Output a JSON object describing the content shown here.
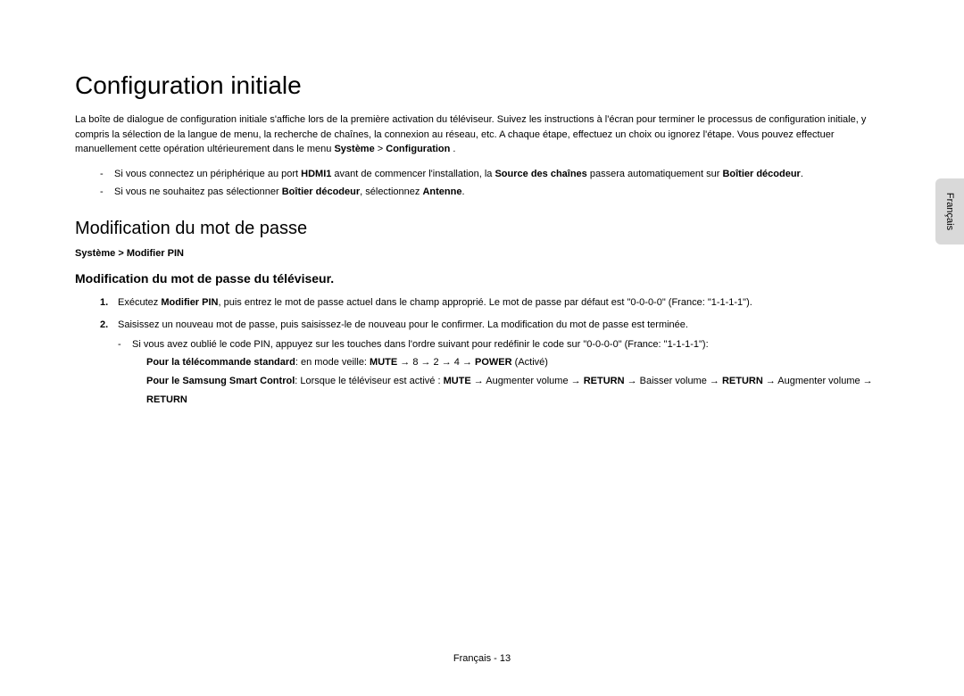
{
  "side_tab": "Français",
  "h1": "Configuration initiale",
  "intro_pre": "La boîte de dialogue de configuration initiale s'affiche lors de la première activation du téléviseur. Suivez les instructions à l'écran pour terminer le processus de configuration initiale, y compris la sélection de la langue de menu, la recherche de chaînes, la connexion au réseau, etc. A chaque étape, effectuez un choix ou ignorez l'étape. Vous pouvez effectuer manuellement cette opération ultérieurement dans le menu ",
  "intro_b1": "Système",
  "intro_gt": " > ",
  "intro_b2": "Configuration",
  "intro_post": " .",
  "bul1_pre": "Si vous connectez un périphérique au port ",
  "bul1_b1": "HDMI1",
  "bul1_mid1": " avant de commencer l'installation, la ",
  "bul1_b2": "Source des chaînes",
  "bul1_mid2": " passera automatiquement sur ",
  "bul1_b3": "Boîtier décodeur",
  "bul1_post": ".",
  "bul2_pre": "Si vous ne souhaitez pas sélectionner ",
  "bul2_b1": "Boîtier décodeur",
  "bul2_mid": ", sélectionnez ",
  "bul2_b2": "Antenne",
  "bul2_post": ".",
  "h2": "Modification du mot de passe",
  "bc_b1": "Système",
  "bc_sep": " > ",
  "bc_b2": "Modifier PIN",
  "h3": "Modification du mot de passe du téléviseur.",
  "n1_num": "1.",
  "n1_pre": "Exécutez ",
  "n1_b": "Modifier PIN",
  "n1_post": ", puis entrez le mot de passe actuel dans le champ approprié. Le mot de passe par défaut est \"0-0-0-0\" (France: \"1-1-1-1\").",
  "n2_num": "2.",
  "n2_text": "Saisissez un nouveau mot de passe, puis saisissez-le de nouveau pour le confirmer. La modification du mot de passe est terminée.",
  "d1_text": "Si vous avez oublié le code PIN, appuyez sur les touches dans l'ordre suivant pour redéfinir le code sur \"0-0-0-0\" (France: \"1-1-1-1\"):",
  "r1_b1": "Pour la télécommande standard",
  "r1_mid1": ": en mode veille: ",
  "r1_b2": "MUTE",
  "r1_mid2": " → 8 → 2 → 4 → ",
  "r1_b3": "POWER",
  "r1_post": " (Activé)",
  "r2_b1": "Pour le Samsung Smart Control",
  "r2_mid1": ": Lorsque le téléviseur est activé : ",
  "r2_b2": "MUTE",
  "r2_mid2": " → Augmenter volume → ",
  "r2_b3": "RETURN",
  "r2_mid3": " → Baisser volume → ",
  "r2_b4": "RETURN",
  "r2_mid4": " → Augmenter volume → ",
  "r2_b5": "RETURN",
  "footer": "Français - 13"
}
